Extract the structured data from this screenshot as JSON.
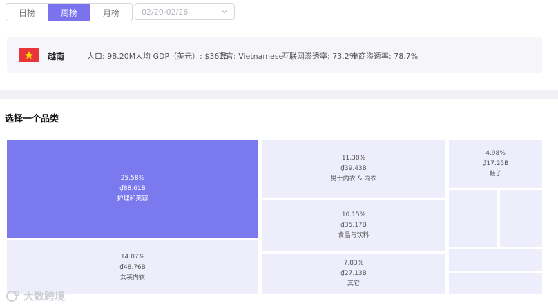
{
  "tabs": [
    {
      "label": "日榜"
    },
    {
      "label": "周榜"
    },
    {
      "label": "月榜"
    }
  ],
  "date_range": {
    "placeholder": "02/20-02/26"
  },
  "country": {
    "name": "越南",
    "flag_color": "#e8353a",
    "flag_star_color": "#ffdd00",
    "population": "人口: 98.20M",
    "gdp": "人均 GDP（美元）: $3615",
    "language": "语言: Vietnamese",
    "internet": "互联网渗透率: 73.2%",
    "ecommerce": "电商渗透率: 78.7%"
  },
  "section_title": "选择一个品类",
  "categories": [
    {
      "percent": "25.58%",
      "amount": "₫88.61B",
      "name": "护理和美容"
    },
    {
      "percent": "14.07%",
      "amount": "₫48.76B",
      "name": "女装内衣"
    },
    {
      "percent": "11.38%",
      "amount": "₫39.43B",
      "name": "男士内衣 & 内衣"
    },
    {
      "percent": "10.15%",
      "amount": "₫35.17B",
      "name": "食品与饮料"
    },
    {
      "percent": "7.83%",
      "amount": "₫27.13B",
      "name": "其它"
    },
    {
      "percent": "4.98%",
      "amount": "₫17.25B",
      "name": "鞋子"
    }
  ],
  "watermark": "大数跨境",
  "colors": {
    "accent": "#7b73ee",
    "tile": "#ededfb",
    "tile_selected": "#7b79ee"
  }
}
